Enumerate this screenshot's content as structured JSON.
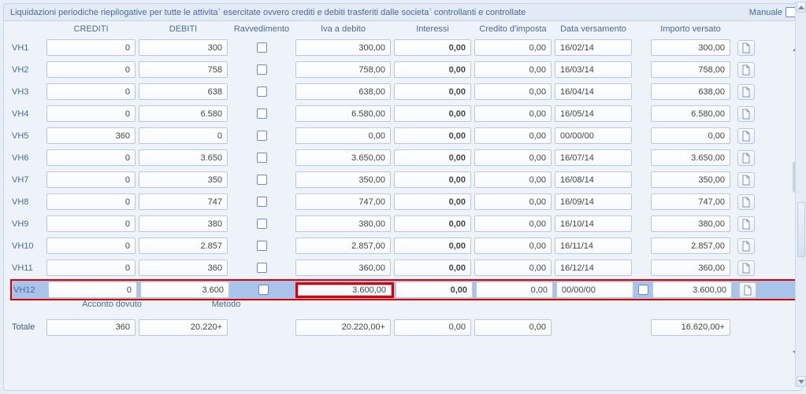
{
  "header": {
    "title": "Liquidazioni periodiche riepilogative per tutte le attivita` esercitate ovvero crediti e debiti trasferiti dalle societa` controllanti e controllate",
    "manual_label": "Manuale"
  },
  "columns": {
    "crediti": "CREDITI",
    "debiti": "DEBITI",
    "ravvedimento": "Ravvedimento",
    "iva_debito": "Iva a debito",
    "interessi": "Interessi",
    "credito_imposta": "Credito d'imposta",
    "data_versamento": "Data versamento",
    "importo_versato": "Importo versato"
  },
  "rows": [
    {
      "label": "VH1",
      "crediti": "0",
      "debiti": "300",
      "iva": "300,00",
      "interessi": "0,00",
      "cimp": "0,00",
      "data": "16/02/14",
      "imp": "300,00"
    },
    {
      "label": "VH2",
      "crediti": "0",
      "debiti": "758",
      "iva": "758,00",
      "interessi": "0,00",
      "cimp": "0,00",
      "data": "16/03/14",
      "imp": "758,00"
    },
    {
      "label": "VH3",
      "crediti": "0",
      "debiti": "638",
      "iva": "638,00",
      "interessi": "0,00",
      "cimp": "0,00",
      "data": "16/04/14",
      "imp": "638,00"
    },
    {
      "label": "VH4",
      "crediti": "0",
      "debiti": "6.580",
      "iva": "6.580,00",
      "interessi": "0,00",
      "cimp": "0,00",
      "data": "16/05/14",
      "imp": "6.580,00"
    },
    {
      "label": "VH5",
      "crediti": "360",
      "debiti": "0",
      "iva": "0,00",
      "interessi": "0,00",
      "cimp": "0,00",
      "data": "00/00/00",
      "imp": "0,00"
    },
    {
      "label": "VH6",
      "crediti": "0",
      "debiti": "3.650",
      "iva": "3.650,00",
      "interessi": "0,00",
      "cimp": "0,00",
      "data": "16/07/14",
      "imp": "3.650,00"
    },
    {
      "label": "VH7",
      "crediti": "0",
      "debiti": "350",
      "iva": "350,00",
      "interessi": "0,00",
      "cimp": "0,00",
      "data": "16/08/14",
      "imp": "350,00"
    },
    {
      "label": "VH8",
      "crediti": "0",
      "debiti": "747",
      "iva": "747,00",
      "interessi": "0,00",
      "cimp": "0,00",
      "data": "16/09/14",
      "imp": "747,00"
    },
    {
      "label": "VH9",
      "crediti": "0",
      "debiti": "380",
      "iva": "380,00",
      "interessi": "0,00",
      "cimp": "0,00",
      "data": "16/10/14",
      "imp": "380,00"
    },
    {
      "label": "VH10",
      "crediti": "0",
      "debiti": "2.857",
      "iva": "2.857,00",
      "interessi": "0,00",
      "cimp": "0,00",
      "data": "16/11/14",
      "imp": "2.857,00"
    },
    {
      "label": "VH11",
      "crediti": "0",
      "debiti": "360",
      "iva": "360,00",
      "interessi": "0,00",
      "cimp": "0,00",
      "data": "16/12/14",
      "imp": "360,00"
    },
    {
      "label": "VH12",
      "crediti": "0",
      "debiti": "3.600",
      "iva": "3.600,00",
      "interessi": "0,00",
      "cimp": "0,00",
      "data": "00/00/00",
      "imp": "3.600,00",
      "highlight": true,
      "extra_cb": true
    }
  ],
  "subrow": {
    "acconto": "Acconto dovuto",
    "metodo": "Metodo"
  },
  "totale": {
    "label": "Totale",
    "crediti": "360",
    "debiti": "20.220+",
    "iva": "20.220,00+",
    "interessi": "0,00",
    "cimp": "0,00",
    "imp": "16.620,00+"
  }
}
